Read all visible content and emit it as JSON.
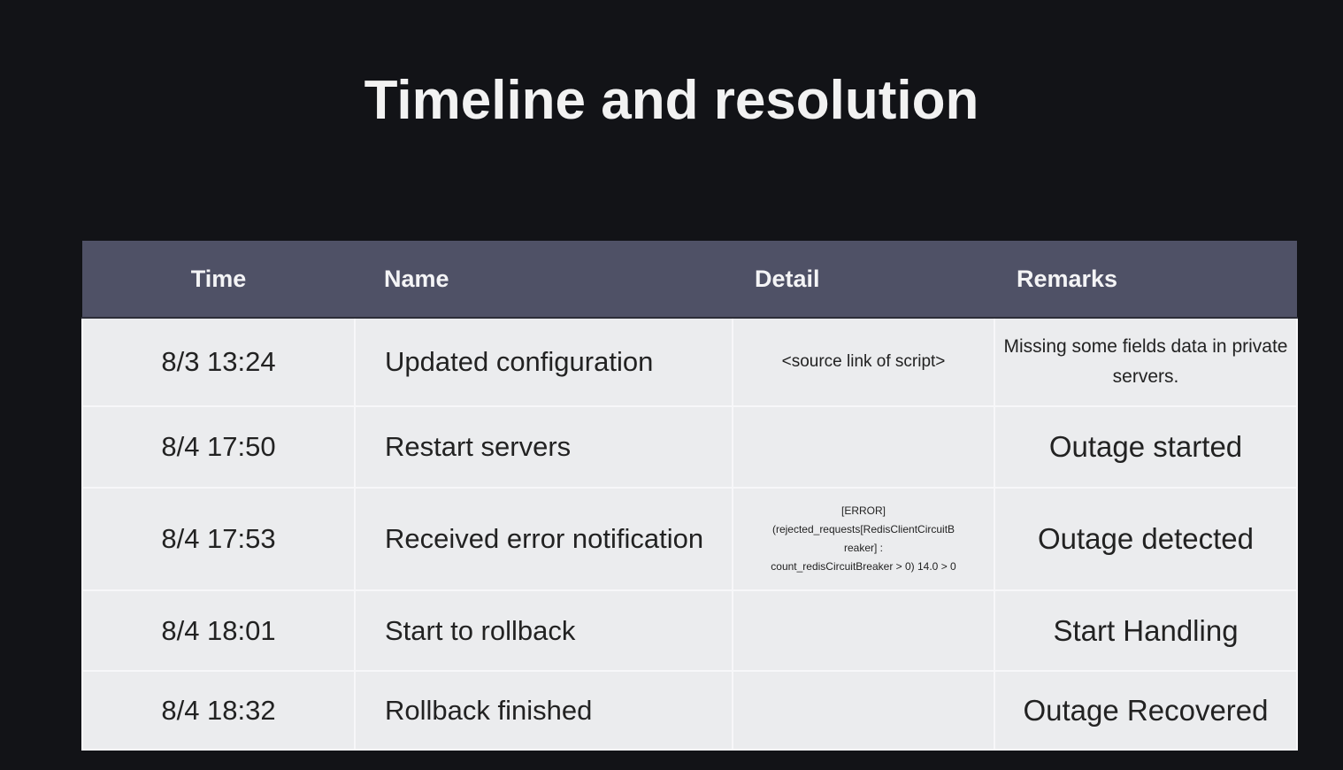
{
  "title": "Timeline and resolution",
  "table": {
    "headers": [
      "Time",
      "Name",
      "Detail",
      "Remarks"
    ],
    "rows": [
      {
        "time": "8/3 13:24",
        "name": "Updated configuration",
        "detail": "<source link of script>",
        "remarks": "Missing  some fields data in private servers."
      },
      {
        "time": "8/4 17:50",
        "name": "Restart servers",
        "detail": "",
        "remarks": "Outage started"
      },
      {
        "time": "8/4 17:53",
        "name": "Received error notification",
        "detail_lines": [
          "[ERROR]",
          "(rejected_requests[RedisClientCircuitB",
          "reaker] :",
          "count_redisCircuitBreaker > 0) 14.0 > 0"
        ],
        "remarks": "Outage detected"
      },
      {
        "time": "8/4 18:01",
        "name": "Start to rollback",
        "detail": "",
        "remarks": "Start Handling"
      },
      {
        "time": "8/4 18:32",
        "name": "Rollback finished",
        "detail": "",
        "remarks": "Outage Recovered"
      }
    ]
  }
}
